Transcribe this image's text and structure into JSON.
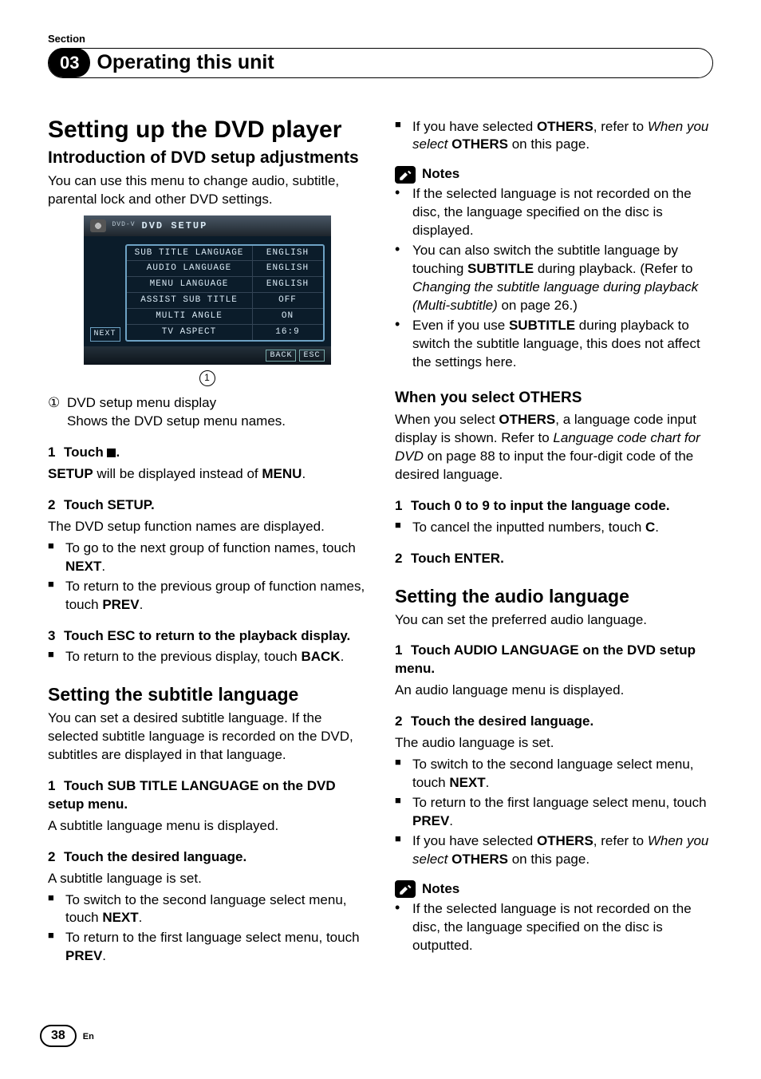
{
  "header": {
    "section_label": "Section",
    "section_no": "03",
    "title": "Operating this unit"
  },
  "left": {
    "h1": "Setting up the DVD player",
    "h2": "Introduction of DVD setup adjustments",
    "intro": "You can use this menu to change audio, subtitle, parental lock and other DVD settings.",
    "shot": {
      "title": "DVD SETUP",
      "brand": "DVD-V",
      "rows": [
        {
          "label": "SUB TITLE LANGUAGE",
          "val": "ENGLISH"
        },
        {
          "label": "AUDIO LANGUAGE",
          "val": "ENGLISH"
        },
        {
          "label": "MENU LANGUAGE",
          "val": "ENGLISH"
        },
        {
          "label": "ASSIST SUB TITLE",
          "val": "OFF"
        },
        {
          "label": "MULTI ANGLE",
          "val": "ON"
        },
        {
          "label": "TV ASPECT",
          "val": "16:9"
        }
      ],
      "next": "NEXT",
      "back": "BACK",
      "esc": "ESC"
    },
    "cap_no": "1",
    "cap_t": "DVD setup menu display",
    "cap_d": "Shows the DVD setup menu names.",
    "s1": {
      "num": "1",
      "title_a": "Touch ",
      "title_b": ".",
      "body_a": "SETUP",
      "body_b": " will be displayed instead of ",
      "body_c": "MENU",
      "body_d": "."
    },
    "s2": {
      "num": "2",
      "title": "Touch SETUP.",
      "body": "The DVD setup function names are displayed.",
      "b1a": "To go to the next group of function names, touch ",
      "b1b": "NEXT",
      "b1c": ".",
      "b2a": "To return to the previous group of function names, touch ",
      "b2b": "PREV",
      "b2c": "."
    },
    "s3": {
      "num": "3",
      "title": "Touch ESC to return to the playback display.",
      "b1a": "To return to the previous display, touch ",
      "b1b": "BACK",
      "b1c": "."
    },
    "subL": {
      "h": "Setting the subtitle language",
      "p": "You can set a desired subtitle language. If the selected subtitle language is recorded on the DVD, subtitles are displayed in that language.",
      "s1": {
        "num": "1",
        "title": "Touch SUB TITLE LANGUAGE on the DVD setup menu.",
        "body": "A subtitle language menu is displayed."
      },
      "s2": {
        "num": "2",
        "title": "Touch the desired language.",
        "body": "A subtitle language is set.",
        "b1a": "To switch to the second language select menu, touch ",
        "b1b": "NEXT",
        "b1c": ".",
        "b2a": "To return to the first language select menu, touch ",
        "b2b": "PREV",
        "b2c": "."
      }
    }
  },
  "right": {
    "top": {
      "a": "If you have selected ",
      "b": "OTHERS",
      "c": ", refer to ",
      "d": "When you select ",
      "e": "OTHERS",
      "f": " on this page."
    },
    "notes_label": "Notes",
    "n1": "If the selected language is not recorded on the disc, the language specified on the disc is displayed.",
    "n2": {
      "a": "You can also switch the subtitle language by touching ",
      "b": "SUBTITLE",
      "c": " during playback. (Refer to ",
      "d": "Changing the subtitle language during playback (Multi-subtitle)",
      "e": " on page 26.)"
    },
    "n3": {
      "a": "Even if you use ",
      "b": "SUBTITLE",
      "c": " during playback to switch the subtitle language, this does not affect the settings here."
    },
    "wo": {
      "h": "When you select ",
      "hw": "OTHERS",
      "p": {
        "a": "When you select ",
        "b": "OTHERS",
        "c": ", a language code input display is shown. Refer to ",
        "d": "Language code chart for DVD",
        "e": " on page 88 to input the four-digit code of the desired language."
      },
      "s1": {
        "num": "1",
        "title": "Touch 0 to 9 to input the language code.",
        "b1a": "To cancel the inputted numbers, touch ",
        "b1b": "C",
        "b1c": "."
      },
      "s2": {
        "num": "2",
        "title": "Touch ENTER."
      }
    },
    "aud": {
      "h": "Setting the audio language",
      "p": "You can set the preferred audio language.",
      "s1": {
        "num": "1",
        "title": "Touch AUDIO LANGUAGE on the DVD setup menu.",
        "body": "An audio language menu is displayed."
      },
      "s2": {
        "num": "2",
        "title": "Touch the desired language.",
        "body": "The audio language is set.",
        "b1a": "To switch to the second language select menu, touch ",
        "b1b": "NEXT",
        "b1c": ".",
        "b2a": "To return to the first language select menu, touch ",
        "b2b": "PREV",
        "b2c": ".",
        "b3a": "If you have selected ",
        "b3b": "OTHERS",
        "b3c": ", refer to ",
        "b3d": "When you select ",
        "b3e": "OTHERS",
        "b3f": " on this page."
      }
    },
    "notes2_label": "Notes",
    "n21": "If the selected language is not recorded on the disc, the language specified on the disc is outputted."
  },
  "pageno": "38",
  "lang": "En"
}
